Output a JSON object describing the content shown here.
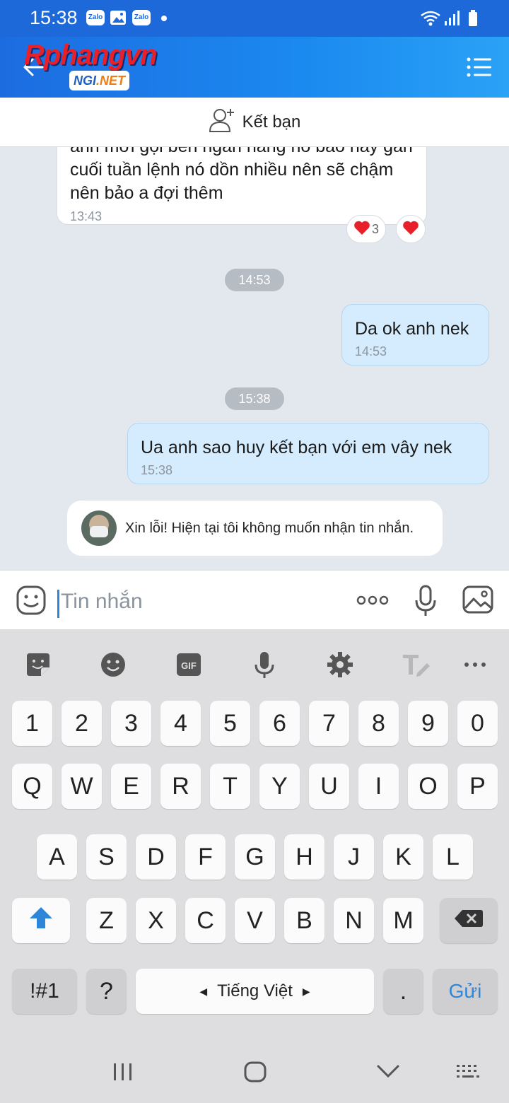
{
  "status_bar": {
    "time": "15:38",
    "notif_zalo_1": "Zalo",
    "notif_zalo_2": "Zalo"
  },
  "header": {
    "logo_main": "Rphangvn",
    "logo_badge_ngi": "NGI",
    "logo_badge_net": ".NET"
  },
  "add_friend": {
    "label": "Kết bạn"
  },
  "messages": {
    "incoming_1": {
      "text": "anh mới gọi bên ngân hàng nó bảo hay gần cuối tuần lệnh nó dồn nhiều nên sẽ chậm nên bảo a đợi thêm",
      "time": "13:43",
      "reaction_count": "3"
    },
    "divider_1": "14:53",
    "outgoing_1": {
      "text": "Da ok anh nek",
      "time": "14:53"
    },
    "divider_2": "15:38",
    "outgoing_2": {
      "text": "Ua anh sao huy kết bạn với em vây nek",
      "time": "15:38"
    },
    "system_note": "Xin lỗi! Hiện tại tôi không muốn nhận tin nhắn."
  },
  "input": {
    "placeholder": "Tin nhắn"
  },
  "keyboard": {
    "toolbar_gif": "GIF",
    "row_numbers": [
      "1",
      "2",
      "3",
      "4",
      "5",
      "6",
      "7",
      "8",
      "9",
      "0"
    ],
    "row_1": [
      "Q",
      "W",
      "E",
      "R",
      "T",
      "Y",
      "U",
      "I",
      "O",
      "P"
    ],
    "row_2": [
      "A",
      "S",
      "D",
      "F",
      "G",
      "H",
      "J",
      "K",
      "L"
    ],
    "row_3": [
      "Z",
      "X",
      "C",
      "V",
      "B",
      "N",
      "M"
    ],
    "symbols_key": "!#1",
    "question_key": "?",
    "space_label": "Tiếng Việt",
    "period_key": ".",
    "send_key": "Gửi"
  },
  "colors": {
    "accent": "#1e69d9",
    "send": "#2d86d8",
    "heart": "#e8202a"
  }
}
